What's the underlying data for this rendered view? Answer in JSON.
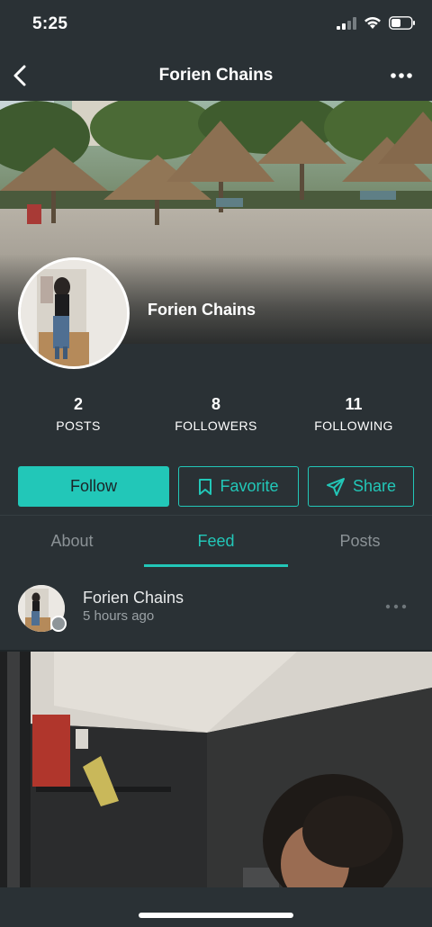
{
  "status_bar": {
    "time": "5:25"
  },
  "nav": {
    "title": "Forien Chains",
    "back_icon": "chevron-left-icon",
    "more_icon": "more-horizontal-icon"
  },
  "profile": {
    "name": "Forien Chains",
    "stats": [
      {
        "value": "2",
        "label": "POSTS"
      },
      {
        "value": "8",
        "label": "FOLLOWERS"
      },
      {
        "value": "11",
        "label": "FOLLOWING"
      }
    ]
  },
  "actions": {
    "follow_label": "Follow",
    "favorite_label": "Favorite",
    "share_label": "Share"
  },
  "tabs": [
    {
      "label": "About",
      "active": false
    },
    {
      "label": "Feed",
      "active": true
    },
    {
      "label": "Posts",
      "active": false
    }
  ],
  "post": {
    "author": "Forien Chains",
    "time": "5 hours ago"
  },
  "colors": {
    "accent": "#22c7b8",
    "background": "#2a3135",
    "feed_background": "#1f2528"
  }
}
